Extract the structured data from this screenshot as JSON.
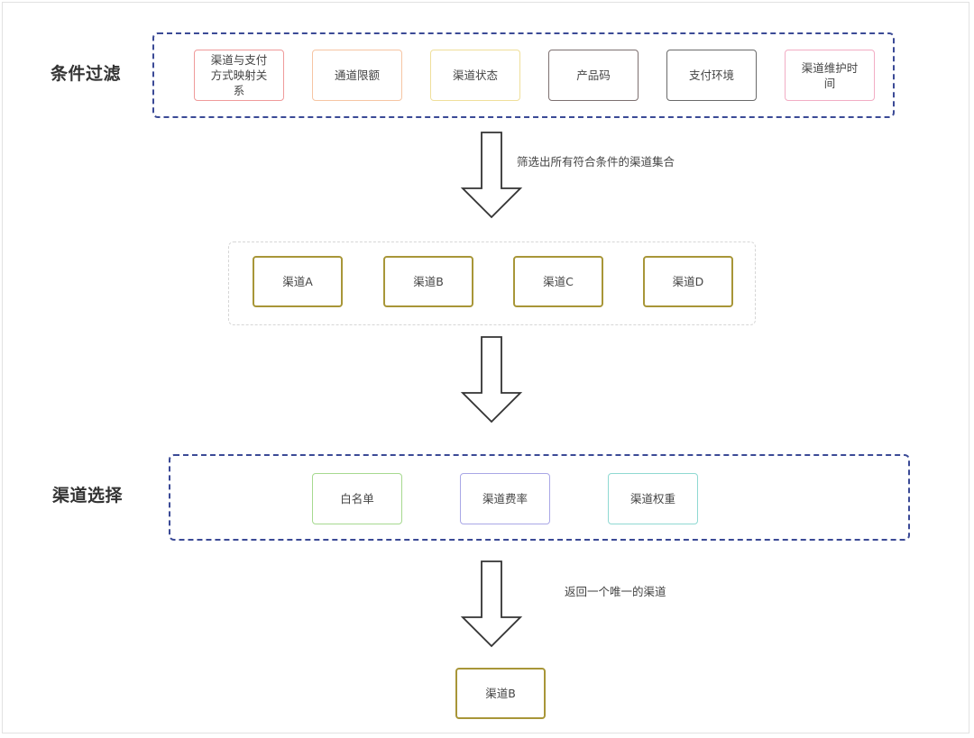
{
  "sections": {
    "filter": {
      "label": "条件过滤",
      "nodes": [
        {
          "label": "渠道与支付\n方式映射关\n系",
          "border_color": "#ef9a9a"
        },
        {
          "label": "通道限额",
          "border_color": "#f6c5a3"
        },
        {
          "label": "渠道状态",
          "border_color": "#efdf9a"
        },
        {
          "label": "产品码",
          "border_color": "#7d7070"
        },
        {
          "label": "支付环境",
          "border_color": "#6a6a6a"
        },
        {
          "label": "渠道维护时\n间",
          "border_color": "#f2adc4"
        }
      ]
    },
    "candidates": {
      "nodes": [
        {
          "label": "渠道A",
          "border_color": "#a89638"
        },
        {
          "label": "渠道B",
          "border_color": "#a89638"
        },
        {
          "label": "渠道C",
          "border_color": "#a89638"
        },
        {
          "label": "渠道D",
          "border_color": "#a89638"
        }
      ]
    },
    "selection": {
      "label": "渠道选择",
      "nodes": [
        {
          "label": "白名单",
          "border_color": "#a6d98f"
        },
        {
          "label": "渠道费率",
          "border_color": "#a9a7e6"
        },
        {
          "label": "渠道权重",
          "border_color": "#8fd9d2"
        }
      ]
    },
    "result": {
      "node": {
        "label": "渠道B",
        "border_color": "#a89638"
      }
    }
  },
  "arrows": [
    {
      "label": "筛选出所有符合条件的渠道集合"
    },
    {
      "label": ""
    },
    {
      "label": "返回一个唯一的渠道"
    }
  ],
  "colors": {
    "group_dashed_border": "#3b4a96",
    "candidate_group_border": "#d6d6d6",
    "arrow_stroke": "#333333"
  }
}
